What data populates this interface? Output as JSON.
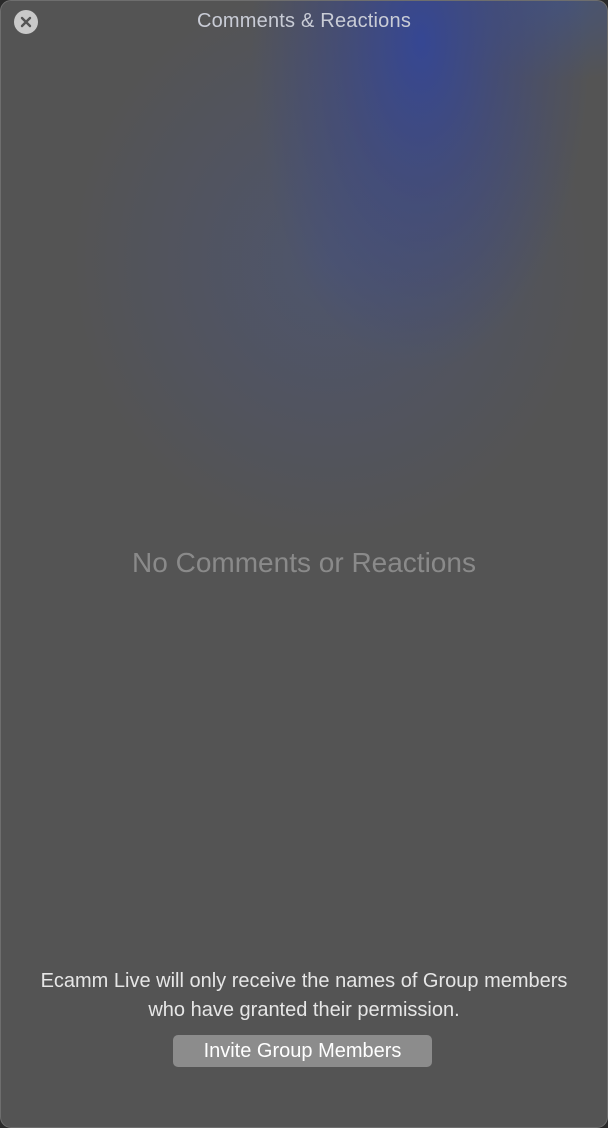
{
  "window": {
    "title": "Comments & Reactions",
    "close_icon": "close-icon"
  },
  "main": {
    "empty_message": "No Comments or Reactions"
  },
  "footer": {
    "note": "Ecamm Live will only receive the names of Group members who have granted their permission.",
    "invite_button_label": "Invite Group Members"
  },
  "colors": {
    "background": "#545454",
    "accent_glow": "#3a4a8c",
    "button_bg": "#8c8c8c"
  }
}
